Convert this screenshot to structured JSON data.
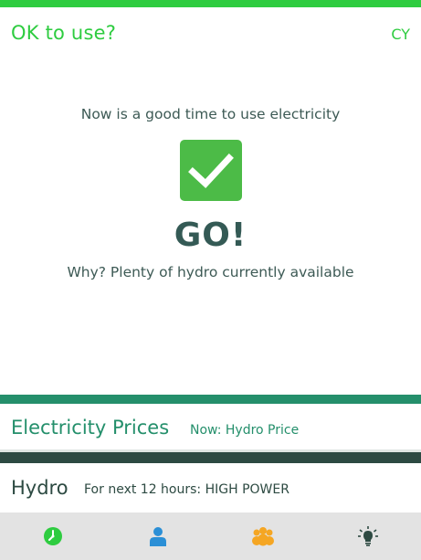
{
  "header": {
    "title": "OK to use?",
    "region": "CY"
  },
  "status": {
    "message": "Now is a good time to use electricity",
    "icon": "checkmark-icon",
    "verdict": "GO!",
    "reason": "Why? Plenty of hydro currently available"
  },
  "prices": {
    "title": "Electricity Prices",
    "subtitle": "Now: Hydro Price"
  },
  "hydro": {
    "title": "Hydro",
    "subtitle": "For next 12 hours: HIGH POWER"
  },
  "nav": {
    "items": [
      {
        "icon": "clock-icon",
        "color": "#2ecc40"
      },
      {
        "icon": "person-icon",
        "color": "#2b8fd6"
      },
      {
        "icon": "group-icon",
        "color": "#f5a623"
      },
      {
        "icon": "lightbulb-icon",
        "color": "#2d4a42"
      }
    ]
  },
  "colors": {
    "accent_green": "#2ecc40",
    "check_green": "#4cbb47",
    "teal": "#248f6b",
    "dark_teal": "#2d4a42",
    "text": "#3d5a55"
  }
}
